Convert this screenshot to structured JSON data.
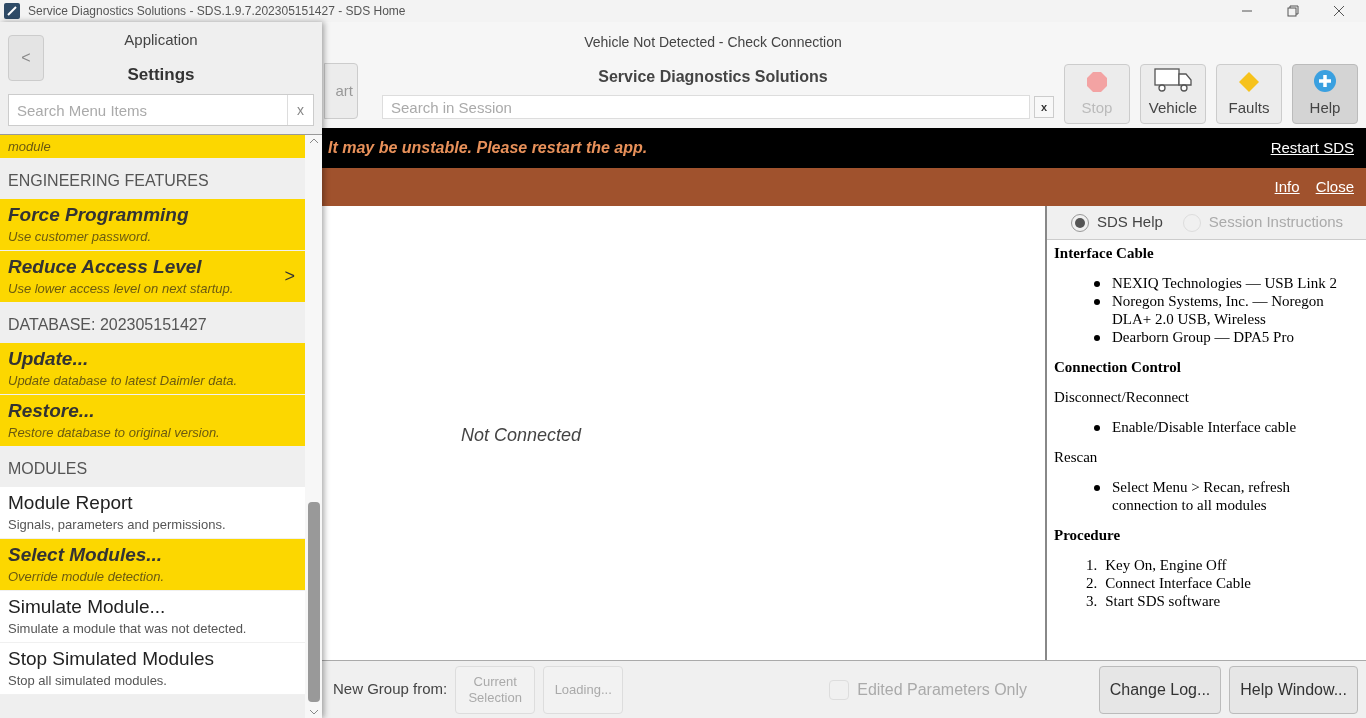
{
  "window": {
    "title": "Service Diagnostics Solutions - SDS.1.9.7.202305151427 - SDS Home"
  },
  "header": {
    "status": "Vehicle Not Detected - Check Connection",
    "app_name": "Service Diagnostics Solutions",
    "start_button": "art",
    "session_search": {
      "placeholder": "Search in Session"
    },
    "clear_button": "x",
    "toolbar": [
      {
        "kind": "stop",
        "label": "Stop",
        "disabled": true,
        "selected": false
      },
      {
        "kind": "vehicle",
        "label": "Vehicle",
        "disabled": false,
        "selected": false
      },
      {
        "kind": "faults",
        "label": "Faults",
        "disabled": false,
        "selected": false
      },
      {
        "kind": "help",
        "label": "Help",
        "disabled": false,
        "selected": true
      }
    ]
  },
  "warning_banner": {
    "message": "It may be unstable. Please restart the app.",
    "link": "Restart SDS"
  },
  "info_bar": {
    "links": [
      "Info",
      "Close"
    ]
  },
  "main": {
    "status": "Not Connected"
  },
  "help_pane": {
    "options": [
      {
        "label": "SDS Help",
        "selected": true,
        "disabled": false
      },
      {
        "label": "Session Instructions",
        "selected": false,
        "disabled": true
      }
    ],
    "sections": [
      {
        "heading": "Interface Cable",
        "blocks": [
          {
            "kind": "bullets",
            "items": [
              "NEXIQ Technologies — USB Link 2",
              "Noregon Systems, Inc. — Noregon DLA+ 2.0 USB, Wireless",
              "Dearborn Group — DPA5 Pro"
            ]
          }
        ]
      },
      {
        "heading": "Connection Control",
        "blocks": [
          {
            "kind": "text",
            "text": "Disconnect/Reconnect"
          },
          {
            "kind": "bullets",
            "items": [
              "Enable/Disable Interface cable"
            ]
          },
          {
            "kind": "text",
            "text": "Rescan"
          },
          {
            "kind": "bullets",
            "items": [
              "Select Menu > Recan, refresh connection to all modules"
            ]
          }
        ]
      },
      {
        "heading": "Procedure",
        "blocks": [
          {
            "kind": "numbered",
            "items": [
              {
                "number": "1.",
                "text": "Key On, Engine Off"
              },
              {
                "number": "2.",
                "text": "Connect Interface Cable"
              },
              {
                "number": "3.",
                "text": "Start SDS software"
              }
            ]
          }
        ]
      }
    ]
  },
  "bottom_bar": {
    "label": "New Group from:",
    "buttons": [
      {
        "label": "Current Selection",
        "disabled": true
      },
      {
        "label": "Loading...",
        "disabled": true
      }
    ],
    "checkbox": {
      "label": "Edited Parameters Only",
      "checked": false,
      "disabled": true
    },
    "right_buttons": [
      "Change Log...",
      "Help Window..."
    ]
  },
  "settings_panel": {
    "caption": "Application",
    "back_button": "<",
    "title": "Settings",
    "search": {
      "placeholder": "Search Menu Items"
    },
    "clear_button": "x",
    "sections": [
      {
        "items": [
          {
            "subtitle": "module",
            "highlighted": true
          }
        ]
      },
      {
        "heading": "ENGINEERING FEATURES",
        "items": [
          {
            "title": "Force Programming",
            "subtitle": "Use customer password.",
            "highlighted": true
          },
          {
            "title": "Reduce Access Level",
            "subtitle": "Use lower access level on next startup.",
            "highlighted": true,
            "chevron": ">"
          }
        ]
      },
      {
        "heading": "DATABASE: 202305151427",
        "items": [
          {
            "title": "Update...",
            "subtitle": "Update database to latest Daimler data.",
            "highlighted": true
          },
          {
            "title": "Restore...",
            "subtitle": "Restore database to original version.",
            "highlighted": true
          }
        ]
      },
      {
        "heading": "MODULES",
        "items": [
          {
            "title": "Module Report",
            "subtitle": "Signals, parameters and permissions.",
            "highlighted": false
          },
          {
            "title": "Select Modules...",
            "subtitle": "Override module detection.",
            "highlighted": true
          },
          {
            "title": "Simulate Module...",
            "subtitle": "Simulate a module that was not detected.",
            "highlighted": false
          },
          {
            "title": "Stop Simulated Modules",
            "subtitle": "Stop all simulated modules.",
            "highlighted": false
          }
        ]
      }
    ]
  }
}
